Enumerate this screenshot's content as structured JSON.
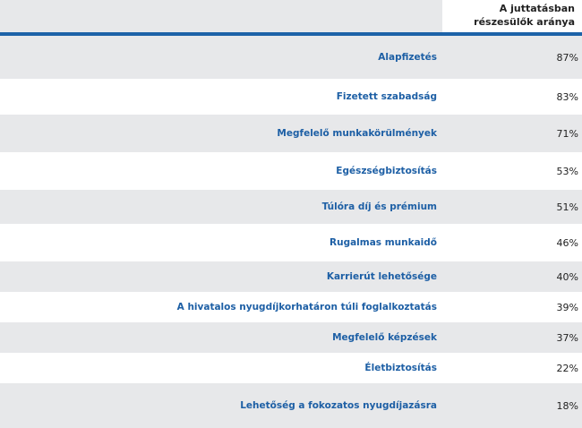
{
  "header": {
    "column_title_line1": "A juttatásban",
    "column_title_line2": "részesülők aránya"
  },
  "rows": [
    {
      "label": "Alapfizetés",
      "value": "87%"
    },
    {
      "label": "Fizetett szabadság",
      "value": "83%"
    },
    {
      "label": "Megfelelő munkakörülmények",
      "value": "71%"
    },
    {
      "label": "Egészségbiztosítás",
      "value": "53%"
    },
    {
      "label": "Túlóra díj és prémium",
      "value": "51%"
    },
    {
      "label": "Rugalmas munkaidő",
      "value": "46%"
    },
    {
      "label": "Karrierút lehetősége",
      "value": "40%"
    },
    {
      "label": "A hivatalos nyugdíjkorhatáron túli foglalkoztatás",
      "value": "39%"
    },
    {
      "label": "Megfelelő képzések",
      "value": "37%"
    },
    {
      "label": "Életbiztosítás",
      "value": "22%"
    },
    {
      "label": "Lehetőség a fokozatos nyugdíjazásra",
      "value": "18%"
    }
  ],
  "colors": {
    "accent_blue": "#1d63a8",
    "label_blue": "#1d5fa5",
    "stripe_gray": "#e7e8ea"
  }
}
